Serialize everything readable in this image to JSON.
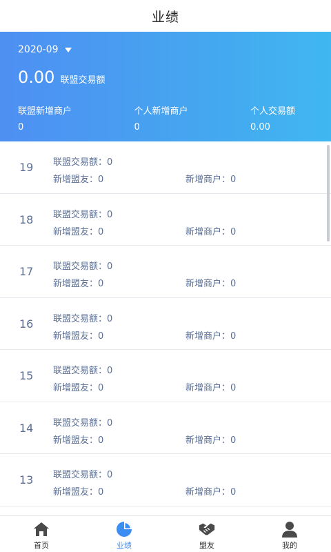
{
  "header": {
    "title": "业绩"
  },
  "summary": {
    "month": "2020-09",
    "total_amount": "0.00",
    "total_label": "联盟交易额",
    "stats": [
      {
        "label": "联盟新增商户",
        "value": "0"
      },
      {
        "label": "个人新增商户",
        "value": "0"
      },
      {
        "label": "个人交易额",
        "value": "0.00"
      }
    ]
  },
  "daily_rows": [
    {
      "day": "19",
      "alliance_amount": "联盟交易额：0",
      "new_allies": "新增盟友：0",
      "new_merchants": "新增商户：0"
    },
    {
      "day": "18",
      "alliance_amount": "联盟交易额：0",
      "new_allies": "新增盟友：0",
      "new_merchants": "新增商户：0"
    },
    {
      "day": "17",
      "alliance_amount": "联盟交易额：0",
      "new_allies": "新增盟友：0",
      "new_merchants": "新增商户：0"
    },
    {
      "day": "16",
      "alliance_amount": "联盟交易额：0",
      "new_allies": "新增盟友：0",
      "new_merchants": "新增商户：0"
    },
    {
      "day": "15",
      "alliance_amount": "联盟交易额：0",
      "new_allies": "新增盟友：0",
      "new_merchants": "新增商户：0"
    },
    {
      "day": "14",
      "alliance_amount": "联盟交易额：0",
      "new_allies": "新增盟友：0",
      "new_merchants": "新增商户：0"
    },
    {
      "day": "13",
      "alliance_amount": "联盟交易额：0",
      "new_allies": "新增盟友：0",
      "new_merchants": "新增商户：0"
    }
  ],
  "tabbar": {
    "items": [
      {
        "label": "首页",
        "icon": "home-icon"
      },
      {
        "label": "业绩",
        "icon": "pie-chart-icon"
      },
      {
        "label": "盟友",
        "icon": "handshake-icon"
      },
      {
        "label": "我的",
        "icon": "user-icon"
      }
    ],
    "active_index": 1
  },
  "colors": {
    "banner_start": "#4e8ff2",
    "banner_end": "#40b7f1",
    "active_tab": "#3d8ef2",
    "row_text": "#5b6f95"
  }
}
